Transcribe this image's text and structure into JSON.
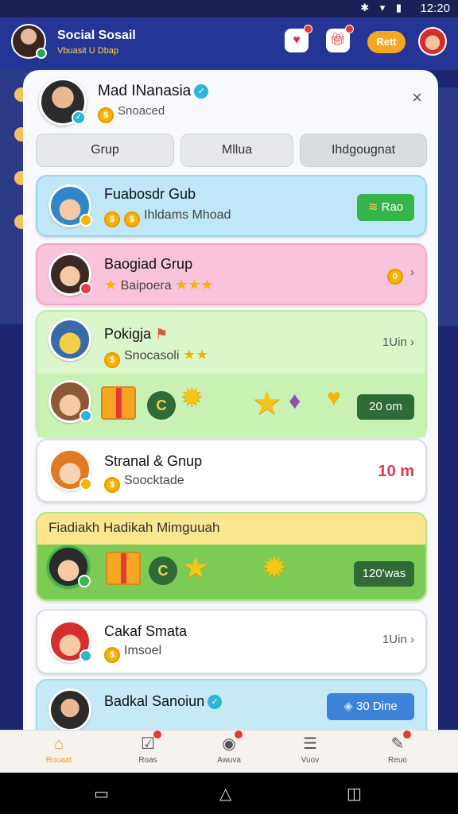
{
  "status_bar": {
    "time": "12:20",
    "icons": "✱ ▾ ▮"
  },
  "header": {
    "title": "Social Sosail",
    "subtitle": "Vbuasit U Dbap",
    "redeem_label": "Rett"
  },
  "modal": {
    "user_name": "Mad INanasia",
    "user_status": "Snoaced",
    "close_icon": "×",
    "tabs": [
      {
        "label": "Grup"
      },
      {
        "label": "Mllua"
      },
      {
        "label": "Ihdgougnat"
      }
    ],
    "cards": [
      {
        "name": "Fuabosdr Gub",
        "sub": "Ihldams Mhoad",
        "action": "Rao",
        "bg": "#bfe7f7"
      },
      {
        "name": "Baogiad Grup",
        "sub": "Baipoera",
        "right": "0",
        "bg": "#f9c4db"
      },
      {
        "name": "Pokigja",
        "sub": "Snocasoli",
        "right": "1Uin",
        "action": "20 om",
        "bg": "#dcf6cc"
      },
      {
        "name": "Stranal & Gnup",
        "sub": "Soocktade",
        "right": "10 m",
        "bg": "#ffffff"
      },
      {
        "banner": "Fiadiakh Hadikah Mimguuah",
        "action": "120'was",
        "bg": "#8fd567"
      },
      {
        "name": "Cakaf Smata",
        "sub": "Imsoel",
        "right": "1Uin",
        "bg": "#ffffff"
      },
      {
        "name": "Badkal Sanoiun",
        "action": "30 Dine",
        "bg": "#c6e9f6"
      }
    ]
  },
  "bottom_nav": [
    {
      "label": "Rooaat",
      "icon": "home-icon"
    },
    {
      "label": "Roas",
      "icon": "checklist-icon"
    },
    {
      "label": "Awuva",
      "icon": "disc-icon"
    },
    {
      "label": "Vuov",
      "icon": "list-icon"
    },
    {
      "label": "Reuo",
      "icon": "chat-icon"
    }
  ],
  "colors": {
    "accent": "#f59a1b",
    "header": "#243596",
    "green": "#3fb24a",
    "blue": "#3f83d9"
  }
}
